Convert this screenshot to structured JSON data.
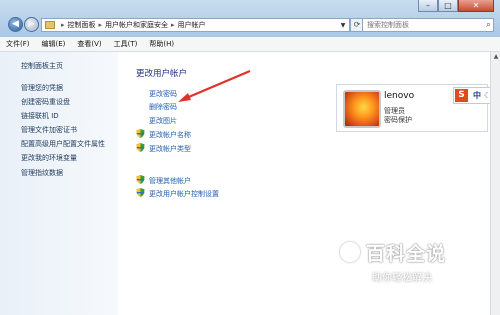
{
  "window": {
    "controls": {
      "minimize": "–",
      "maximize": "□",
      "close": "✕"
    }
  },
  "address": {
    "crumbs": [
      "控制面板",
      "用户帐户和家庭安全",
      "用户帐户"
    ],
    "separator": "▸"
  },
  "search": {
    "placeholder": "搜索控制面板"
  },
  "menu": [
    "文件(F)",
    "编辑(E)",
    "查看(V)",
    "工具(T)",
    "帮助(H)"
  ],
  "sidebar": {
    "home": "控制面板主页",
    "links": [
      "管理您的凭据",
      "创建密码重设盘",
      "链接联机 ID",
      "管理文件加密证书",
      "配置高级用户配置文件属性",
      "更改我的环境变量",
      "管理指纹数据"
    ]
  },
  "main": {
    "title": "更改用户帐户",
    "tasks": [
      "更改密码",
      "删除密码",
      "更改图片",
      "更改帐户名称",
      "更改帐户类型"
    ],
    "other_tasks": [
      "管理其他帐户",
      "更改用户帐户控制设置"
    ]
  },
  "user": {
    "name": "lenovo",
    "role": "管理员",
    "status": "密码保护"
  },
  "ime": {
    "logo": "S",
    "mode": "中"
  },
  "watermark": {
    "title": "百科全说",
    "subtitle": "助你轻松解决"
  },
  "colors": {
    "link": "#1f5fb0",
    "title": "#1e3287",
    "arrow": "#e0312b",
    "shield_green": "#3d9a3a",
    "shield_yellow": "#f1c232"
  }
}
